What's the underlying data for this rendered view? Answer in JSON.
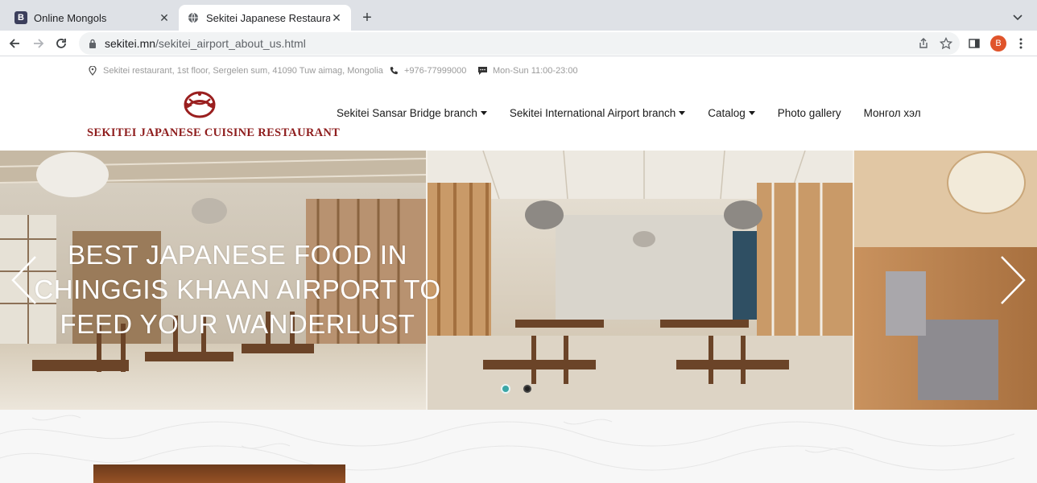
{
  "browser": {
    "tabs": [
      {
        "title": "Online Mongols",
        "favicon": "b-letter-icon",
        "active": false
      },
      {
        "title": "Sekitei Japanese Restaurant",
        "favicon": "globe-icon",
        "active": true
      }
    ],
    "url_host": "sekitei.mn",
    "url_path": "/sekitei_airport_about_us.html",
    "avatar_letter": "B"
  },
  "info": {
    "address": "Sekitei restaurant, 1st floor, Sergelen sum, 41090 Tuw aimag, Mongolia",
    "phone": "+976-77999000",
    "hours": "Mon-Sun 11:00-23:00"
  },
  "logo": {
    "text": "SEKITEI JAPANESE CUISINE RESTAURANT",
    "brand_color": "#8e1d1d"
  },
  "nav": {
    "items": [
      {
        "label": "Sekitei Sansar Bridge branch",
        "dropdown": true
      },
      {
        "label": "Sekitei International Airport branch",
        "dropdown": true
      },
      {
        "label": "Catalog",
        "dropdown": true
      },
      {
        "label": "Photo gallery",
        "dropdown": false
      },
      {
        "label": "Монгол хэл",
        "dropdown": false
      }
    ]
  },
  "hero": {
    "caption_lines": [
      "BEST JAPANESE FOOD IN",
      "CHINGGIS KHAAN AIRPORT TO",
      "FEED YOUR WANDERLUST"
    ],
    "slides_count": 2,
    "active_slide": 1,
    "accent_color": "#3aa6a6"
  }
}
